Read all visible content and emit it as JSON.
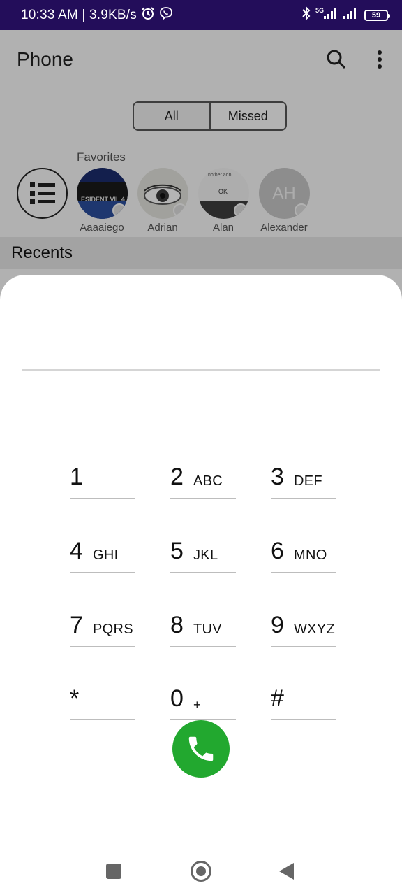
{
  "status_bar": {
    "time": "10:33 AM | 3.9KB/s",
    "network": "5G",
    "battery": "59"
  },
  "app": {
    "title": "Phone",
    "filters": [
      "All",
      "Missed"
    ],
    "favorites_label": "Favorites",
    "favorites": [
      {
        "name": "Aaaaiego",
        "avatar_text": "ESIDENT VIL 4"
      },
      {
        "name": "Adrian"
      },
      {
        "name": "Alan",
        "avatar_text": "OK",
        "avatar_caption": "nother adn"
      },
      {
        "name": "Alexander",
        "initials": "AH"
      }
    ],
    "recents_title": "Recents"
  },
  "dialer": {
    "number_value": "",
    "keys": [
      {
        "digit": "1",
        "letters": ""
      },
      {
        "digit": "2",
        "letters": "ABC"
      },
      {
        "digit": "3",
        "letters": "DEF"
      },
      {
        "digit": "4",
        "letters": "GHI"
      },
      {
        "digit": "5",
        "letters": "JKL"
      },
      {
        "digit": "6",
        "letters": "MNO"
      },
      {
        "digit": "7",
        "letters": "PQRS"
      },
      {
        "digit": "8",
        "letters": "TUV"
      },
      {
        "digit": "9",
        "letters": "WXYZ"
      },
      {
        "digit": "*",
        "letters": ""
      },
      {
        "digit": "0",
        "letters": "+"
      },
      {
        "digit": "#",
        "letters": ""
      }
    ]
  },
  "colors": {
    "status_bar": "#230d5a",
    "call_button": "#22a82f"
  }
}
